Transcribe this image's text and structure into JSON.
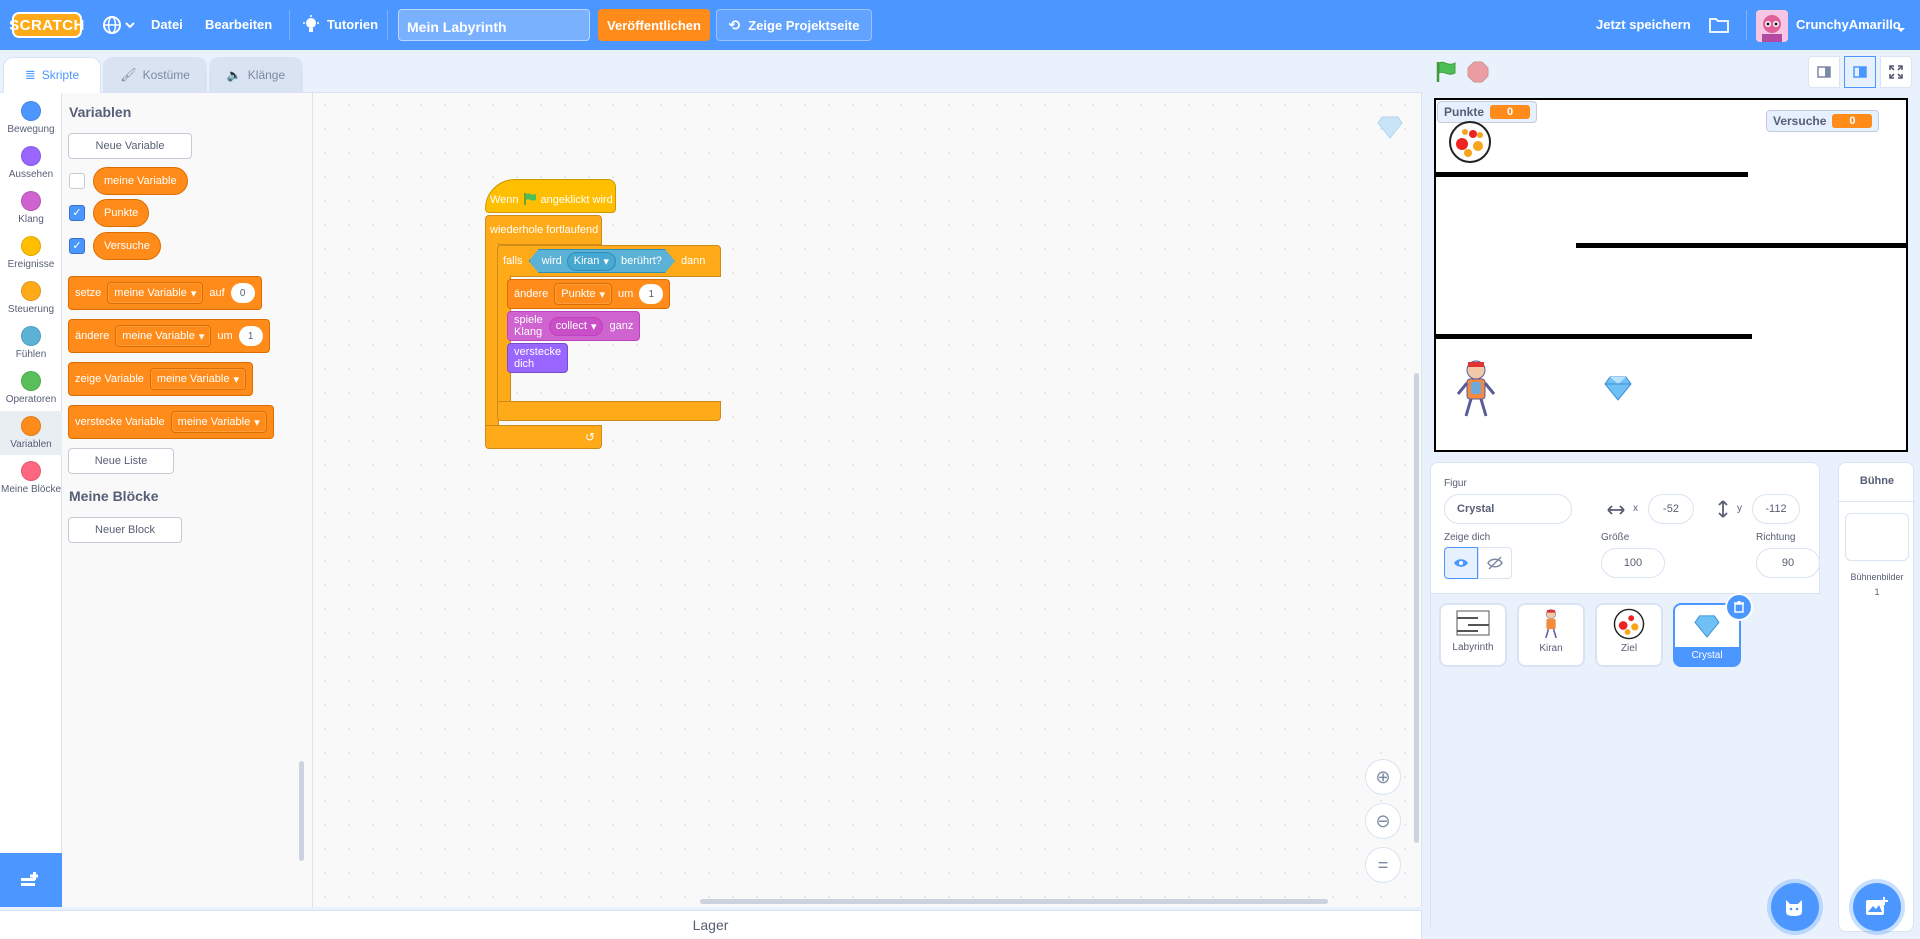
{
  "menu": {
    "logo_text": "SCRATCH",
    "file": "Datei",
    "edit": "Bearbeiten",
    "tutorials": "Tutorien",
    "project_title": "Mein Labyrinth",
    "share": "Veröffentlichen",
    "see_project": "Zeige Projektseite",
    "save_now": "Jetzt speichern",
    "username": "CrunchyAmarillo"
  },
  "tabs": {
    "code": "Skripte",
    "costumes": "Kostüme",
    "sounds": "Klänge"
  },
  "categories": [
    {
      "label": "Bewegung",
      "color": "#4c97ff"
    },
    {
      "label": "Aussehen",
      "color": "#9966ff"
    },
    {
      "label": "Klang",
      "color": "#cf63cf"
    },
    {
      "label": "Ereignisse",
      "color": "#ffbf00"
    },
    {
      "label": "Steuerung",
      "color": "#ffab19"
    },
    {
      "label": "Fühlen",
      "color": "#5cb1d6"
    },
    {
      "label": "Operatoren",
      "color": "#59c059"
    },
    {
      "label": "Variablen",
      "color": "#ff8c1a"
    },
    {
      "label": "Meine Blöcke",
      "color": "#ff6680"
    }
  ],
  "palette": {
    "variables_title": "Variablen",
    "new_variable": "Neue Variable",
    "reporters": [
      {
        "label": "meine Variable",
        "checked": false
      },
      {
        "label": "Punkte",
        "checked": true
      },
      {
        "label": "Versuche",
        "checked": true
      }
    ],
    "set_block": {
      "word": "setze",
      "var": "meine Variable",
      "to": "auf",
      "value": "0"
    },
    "change_block": {
      "word": "ändere",
      "var": "meine Variable",
      "by": "um",
      "value": "1"
    },
    "show_block": {
      "word": "zeige Variable",
      "var": "meine Variable"
    },
    "hide_block": {
      "word": "verstecke Variable",
      "var": "meine Variable"
    },
    "new_list": "Neue Liste",
    "my_blocks_title": "Meine Blöcke",
    "new_block": "Neuer Block"
  },
  "script": {
    "hat_when": "Wenn",
    "hat_clicked": "angeklickt wird",
    "forever": "wiederhole fortlaufend",
    "if": "falls",
    "touching_pre": "wird",
    "touching_target": "Kiran",
    "touching_post": "berührt?",
    "then": "dann",
    "change_word": "ändere",
    "change_var": "Punkte",
    "change_by": "um",
    "change_value": "1",
    "sound_word": "spiele Klang",
    "sound_name": "collect",
    "sound_until": "ganz",
    "hide": "verstecke dich"
  },
  "stage_monitors": [
    {
      "label": "Punkte",
      "value": "0"
    },
    {
      "label": "Versuche",
      "value": "0"
    }
  ],
  "sprite_info": {
    "sprite_label": "Figur",
    "sprite_name": "Crystal",
    "x_label": "x",
    "x": "-52",
    "y_label": "y",
    "y": "-112",
    "show_label": "Zeige dich",
    "size_label": "Größe",
    "size": "100",
    "direction_label": "Richtung",
    "direction": "90"
  },
  "sprites": [
    {
      "name": "Labyrinth",
      "selected": false
    },
    {
      "name": "Kiran",
      "selected": false
    },
    {
      "name": "Ziel",
      "selected": false
    },
    {
      "name": "Crystal",
      "selected": true
    }
  ],
  "stage_panel": {
    "title": "Bühne",
    "backdrops_label": "Bühnenbilder",
    "backdrops_count": "1"
  },
  "backpack": "Lager"
}
